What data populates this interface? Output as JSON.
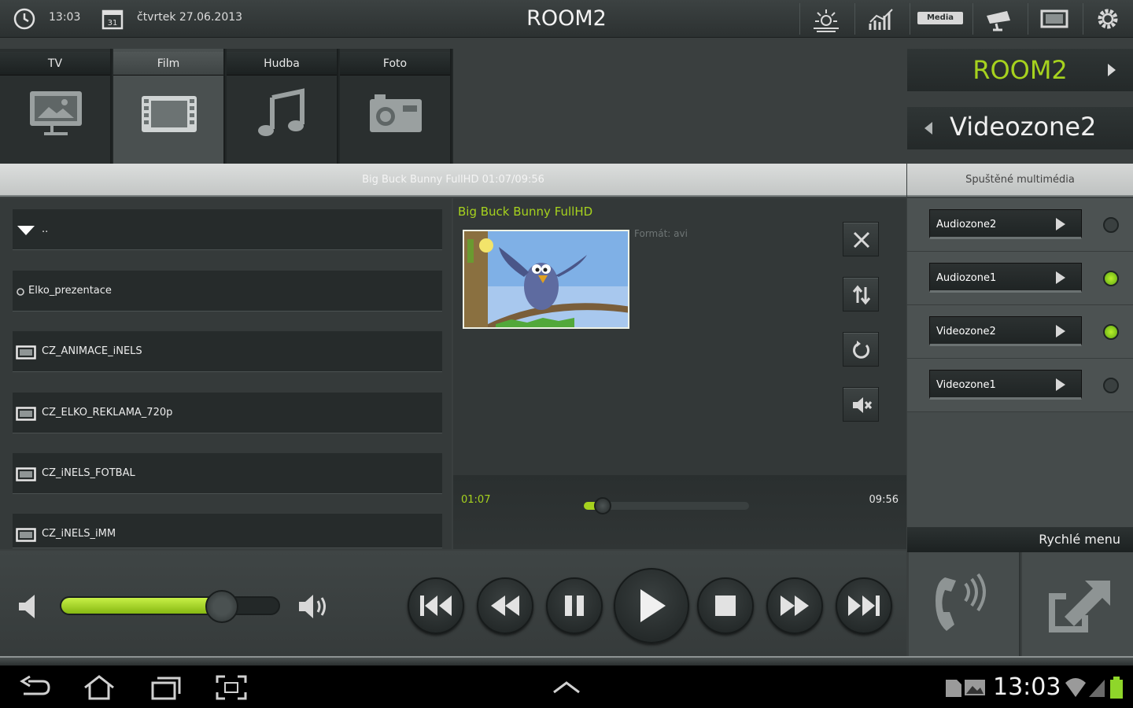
{
  "colors": {
    "accent": "#a6d21e",
    "radio_on": "#7fd21c",
    "background": "#3a3f3f"
  },
  "top_bar": {
    "time": "13:03",
    "date": "čtvrtek 27.06.2013",
    "room_title": "ROOM2",
    "icons": [
      "clock-icon",
      "calendar-icon",
      "weather-icon",
      "chart-icon",
      "media-icon",
      "camera-security-icon",
      "screen-icon",
      "settings-gear-icon"
    ],
    "media_badge": "Media"
  },
  "tabs": [
    {
      "label": "TV",
      "icon": "tv-icon",
      "active": false
    },
    {
      "label": "Film",
      "icon": "film-icon",
      "active": true
    },
    {
      "label": "Hudba",
      "icon": "music-icon",
      "active": false
    },
    {
      "label": "Foto",
      "icon": "camera-icon",
      "active": false
    }
  ],
  "now_playing_bar": "Big Buck Bunny FullHD 01:07/09:56",
  "file_list": [
    {
      "label": "..",
      "icon": "folder-up-icon"
    },
    {
      "label": "Elko_prezentace",
      "icon": "folder-dot-icon"
    },
    {
      "label": "CZ_ANIMACE_iNELS",
      "icon": "video-file-icon"
    },
    {
      "label": "CZ_ELKO_REKLAMA_720p",
      "icon": "video-file-icon"
    },
    {
      "label": "CZ_iNELS_FOTBAL",
      "icon": "video-file-icon"
    },
    {
      "label": "CZ_iNELS_iMM",
      "icon": "video-file-icon"
    }
  ],
  "player": {
    "title": "Big Buck Bunny FullHD",
    "format": "Formát: avi",
    "side_buttons": [
      "close-icon",
      "sort-icon",
      "repeat-icon",
      "mute-icon"
    ],
    "current_time": "01:07",
    "total_time": "09:56",
    "progress": 0.112
  },
  "volume": {
    "level": 0.74
  },
  "transport_buttons": [
    "skip-previous-icon",
    "rewind-icon",
    "pause-icon",
    "play-icon",
    "stop-icon",
    "fast-forward-icon",
    "skip-next-icon"
  ],
  "right_panel": {
    "room": "ROOM2",
    "zone": "Videozone2",
    "running_label": "Spuštěné multimédia",
    "outputs": [
      {
        "label": "Audiozone2",
        "active": false
      },
      {
        "label": "Audiozone1",
        "active": true
      },
      {
        "label": "Videozone2",
        "active": true
      },
      {
        "label": "Videozone1",
        "active": false
      }
    ],
    "quick_menu_label": "Rychlé menu",
    "quick_buttons": [
      "intercom-phone-icon",
      "external-link-icon"
    ]
  },
  "nav_bar": {
    "clock": "13:03",
    "icons": [
      "back-icon",
      "home-icon",
      "recent-apps-icon",
      "screenshot-icon",
      "up-chevron-icon",
      "sd-card-icon",
      "gallery-icon",
      "wifi-icon",
      "signal-icon",
      "battery-icon"
    ]
  }
}
